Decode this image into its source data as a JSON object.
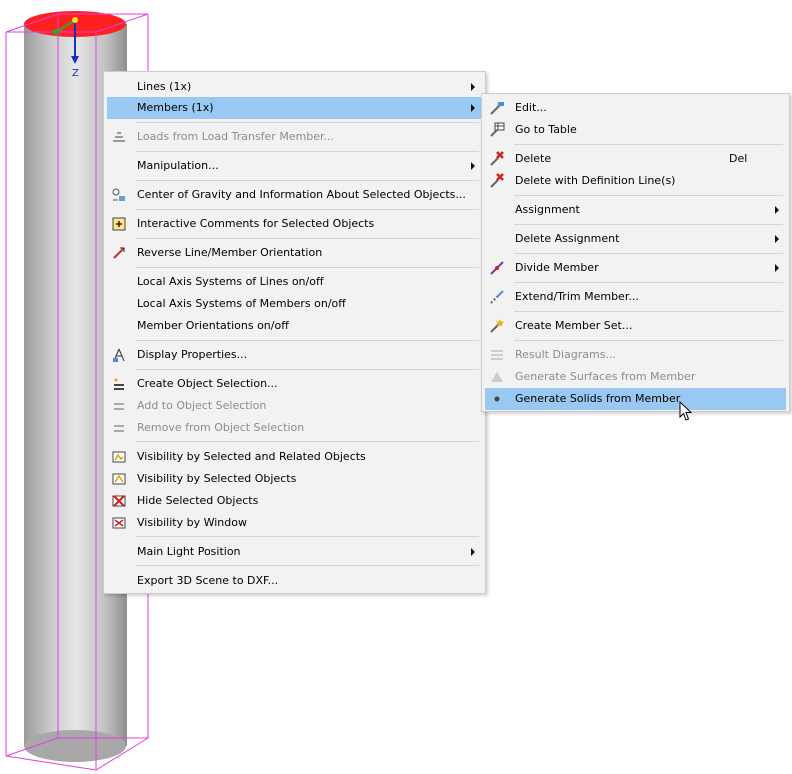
{
  "scene": {
    "axis_label": "Z",
    "colors": {
      "member_body": "#c8c8c8",
      "selection_top": "#ff2020",
      "bounding_box": "#e040e0",
      "axis": "#1a2fc0"
    }
  },
  "main_menu": {
    "items": [
      {
        "label": "Lines (1x)",
        "icon": "",
        "submenu": true,
        "disabled": false
      },
      {
        "label": "Members (1x)",
        "icon": "",
        "submenu": true,
        "disabled": false,
        "highlighted": true
      },
      {
        "label": "Loads from Load Transfer Member...",
        "icon": "load-transfer-icon",
        "submenu": false,
        "disabled": true
      },
      {
        "label": "Manipulation...",
        "icon": "",
        "submenu": true,
        "disabled": false
      },
      {
        "label": "Center of Gravity and Information About Selected Objects...",
        "icon": "center-of-gravity-icon",
        "submenu": false,
        "disabled": false
      },
      {
        "label": "Interactive Comments for Selected Objects",
        "icon": "comments-icon",
        "submenu": false,
        "disabled": false
      },
      {
        "label": "Reverse Line/Member Orientation",
        "icon": "reverse-orientation-icon",
        "submenu": false,
        "disabled": false
      },
      {
        "label": "Local Axis Systems of Lines on/off",
        "icon": "",
        "submenu": false,
        "disabled": false
      },
      {
        "label": "Local Axis Systems of Members on/off",
        "icon": "",
        "submenu": false,
        "disabled": false
      },
      {
        "label": "Member Orientations on/off",
        "icon": "",
        "submenu": false,
        "disabled": false
      },
      {
        "label": "Display Properties...",
        "icon": "display-properties-icon",
        "submenu": false,
        "disabled": false
      },
      {
        "label": "Create Object Selection...",
        "icon": "create-selection-icon",
        "submenu": false,
        "disabled": false
      },
      {
        "label": "Add to Object Selection",
        "icon": "add-selection-icon",
        "submenu": false,
        "disabled": true
      },
      {
        "label": "Remove from Object Selection",
        "icon": "remove-selection-icon",
        "submenu": false,
        "disabled": true
      },
      {
        "label": "Visibility by Selected and Related Objects",
        "icon": "visibility-related-icon",
        "submenu": false,
        "disabled": false
      },
      {
        "label": "Visibility by Selected Objects",
        "icon": "visibility-selected-icon",
        "submenu": false,
        "disabled": false
      },
      {
        "label": "Hide Selected Objects",
        "icon": "hide-objects-icon",
        "submenu": false,
        "disabled": false
      },
      {
        "label": "Visibility by Window",
        "icon": "visibility-window-icon",
        "submenu": false,
        "disabled": false
      },
      {
        "label": "Main Light Position",
        "icon": "",
        "submenu": true,
        "disabled": false
      },
      {
        "label": "Export 3D Scene to DXF...",
        "icon": "",
        "submenu": false,
        "disabled": false
      }
    ]
  },
  "sub_menu": {
    "items": [
      {
        "label": "Edit...",
        "icon": "edit-member-icon",
        "submenu": false,
        "disabled": false
      },
      {
        "label": "Go to Table",
        "icon": "go-to-table-icon",
        "submenu": false,
        "disabled": false
      },
      {
        "label": "Delete",
        "shortcut": "Del",
        "icon": "delete-icon",
        "submenu": false,
        "disabled": false
      },
      {
        "label": "Delete with Definition Line(s)",
        "icon": "delete-with-lines-icon",
        "submenu": false,
        "disabled": false
      },
      {
        "label": "Assignment",
        "icon": "",
        "submenu": true,
        "disabled": false
      },
      {
        "label": "Delete Assignment",
        "icon": "",
        "submenu": true,
        "disabled": false
      },
      {
        "label": "Divide Member",
        "icon": "divide-member-icon",
        "submenu": true,
        "disabled": false
      },
      {
        "label": "Extend/Trim Member...",
        "icon": "extend-trim-icon",
        "submenu": false,
        "disabled": false
      },
      {
        "label": "Create Member Set...",
        "icon": "member-set-icon",
        "submenu": false,
        "disabled": false
      },
      {
        "label": "Result Diagrams...",
        "icon": "result-diagrams-icon",
        "submenu": false,
        "disabled": true
      },
      {
        "label": "Generate Surfaces from Member",
        "icon": "generate-surfaces-icon",
        "submenu": false,
        "disabled": true
      },
      {
        "label": "Generate Solids from Member",
        "icon": "bullet-icon",
        "submenu": false,
        "disabled": false,
        "highlighted": true
      }
    ]
  }
}
